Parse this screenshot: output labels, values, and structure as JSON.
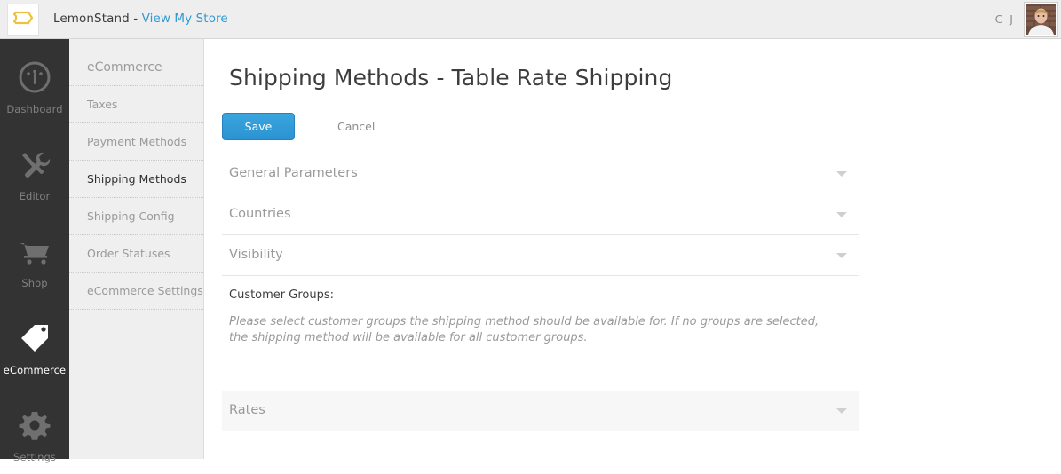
{
  "topbar": {
    "logo_icon": "lemonstand-tag-logo-icon",
    "brand_name": "LemonStand - ",
    "store_link": "View My Store",
    "user_initials": "C J",
    "avatar_icon": "user-avatar-photo"
  },
  "nav_primary": {
    "items": [
      {
        "label": "Dashboard",
        "icon": "gauge-icon",
        "active": false
      },
      {
        "label": "Editor",
        "icon": "wrench-pencil-icon",
        "active": false
      },
      {
        "label": "Shop",
        "icon": "shopping-cart-icon",
        "active": false
      },
      {
        "label": "eCommerce",
        "icon": "price-tag-icon",
        "active": true
      },
      {
        "label": "Settings",
        "icon": "gear-icon",
        "active": false
      }
    ]
  },
  "nav_secondary": {
    "header": "eCommerce",
    "items": [
      {
        "label": "Taxes",
        "active": false
      },
      {
        "label": "Payment Methods",
        "active": false
      },
      {
        "label": "Shipping Methods",
        "active": true
      },
      {
        "label": "Shipping Config",
        "active": false
      },
      {
        "label": "Order Statuses",
        "active": false
      },
      {
        "label": "eCommerce Settings",
        "active": false
      }
    ]
  },
  "main": {
    "title": "Shipping Methods - Table Rate Shipping",
    "save_label": "Save",
    "cancel_label": "Cancel",
    "sections": [
      {
        "label": "General Parameters",
        "caret": "chevron-down-icon"
      },
      {
        "label": "Countries",
        "caret": "chevron-down-icon"
      },
      {
        "label": "Visibility",
        "caret": "chevron-down-icon"
      }
    ],
    "customer_groups": {
      "label": "Customer Groups:",
      "help": "Please select customer groups the shipping method should be available for. If no groups are selected, the shipping method will be available for all customer groups."
    },
    "rates_panel": {
      "label": "Rates",
      "caret": "chevron-down-icon"
    }
  },
  "colors": {
    "accent_blue": "#2e9bd6",
    "logo_yellow": "#edc13f",
    "sidebar_dark": "#333333",
    "sidebar_light": "#efefef"
  }
}
